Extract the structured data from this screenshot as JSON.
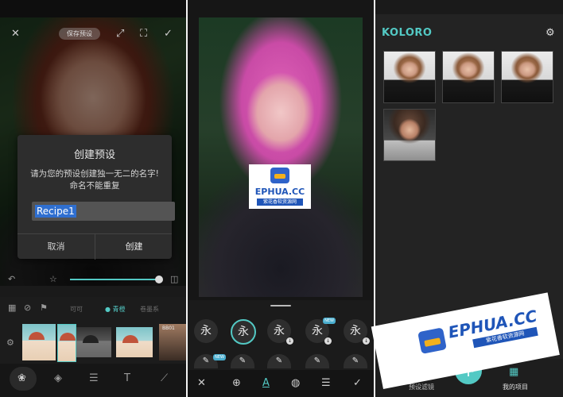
{
  "panel1": {
    "preset_pill": "保存预设",
    "dialog": {
      "title": "创建预设",
      "message_line1": "请为您的预设创建独一无二的名字!",
      "message_line2": "命名不能重复",
      "input_value": "Recipe1",
      "cancel": "取消",
      "create": "创建"
    },
    "filter_tabs": [
      "可可",
      "青橙",
      "卷墨系"
    ],
    "filter_badge": "BB01"
  },
  "panel2": {
    "font_chips": [
      "永",
      "永",
      "永",
      "永",
      "永"
    ],
    "chip_badge_new": "NEW",
    "row2_badge": "NEW"
  },
  "panel3": {
    "app_title": "KOLORO",
    "accent": "#53c9c4",
    "nav_filters": "预设滤镜",
    "nav_projects": "我的项目",
    "fab": "+"
  },
  "watermark": {
    "brand": "EPHUA.CC",
    "tagline": "紫花香软资源网"
  }
}
